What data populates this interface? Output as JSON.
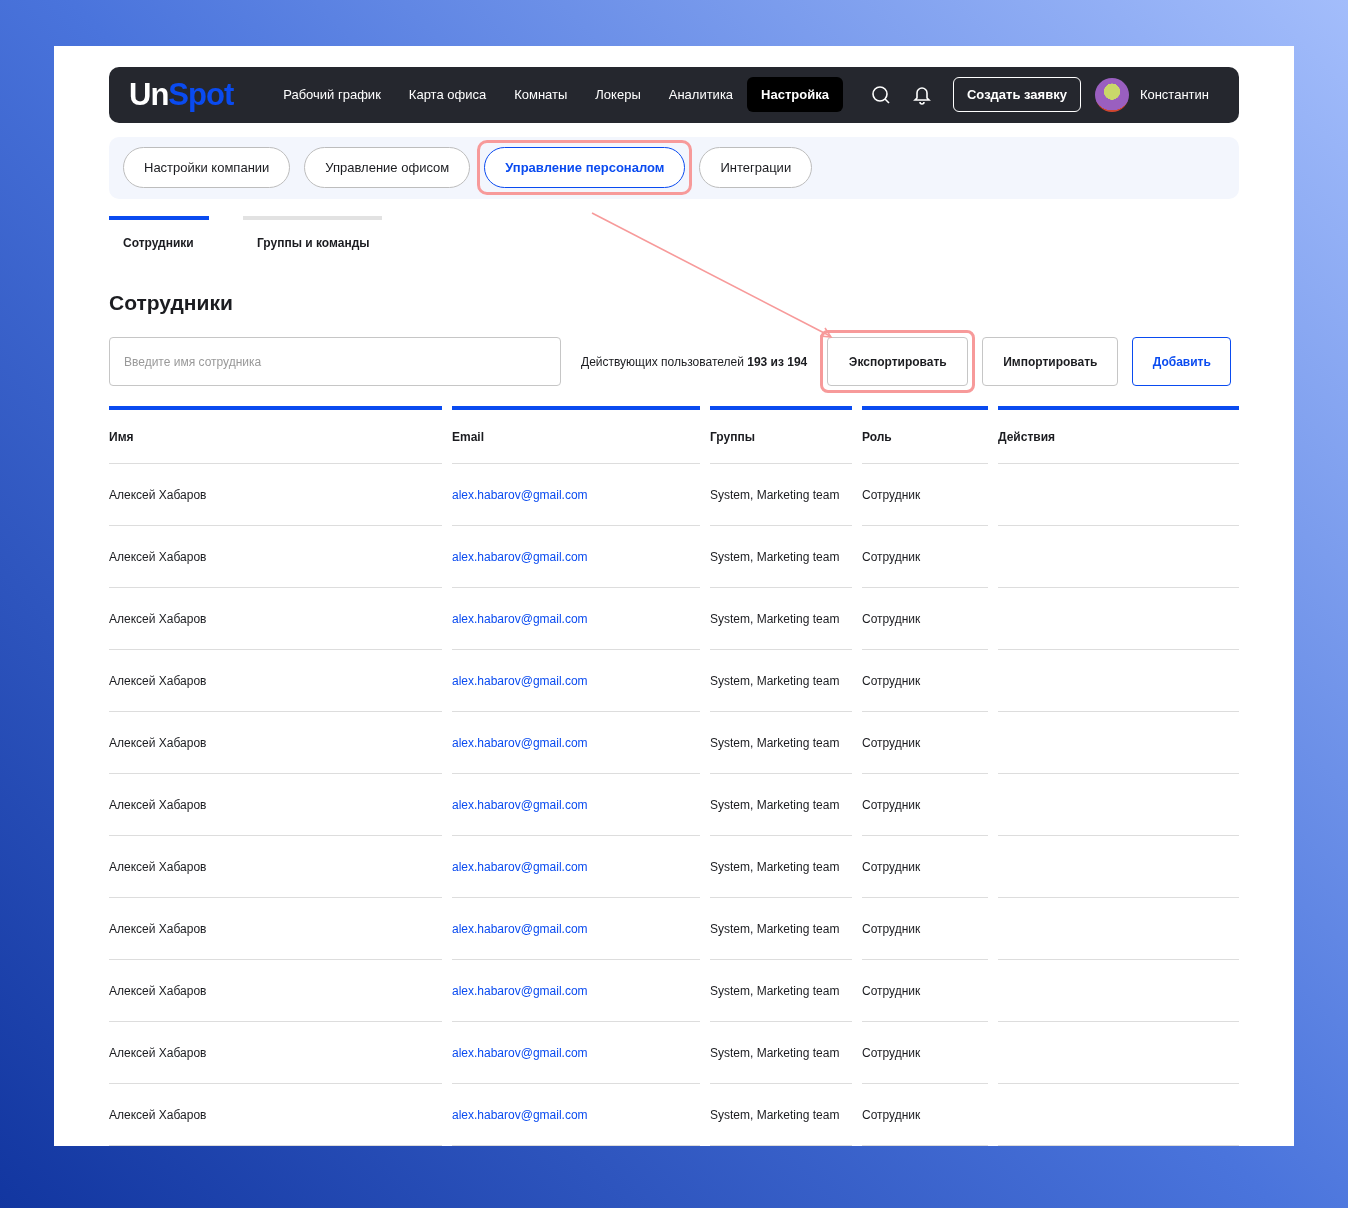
{
  "nav": {
    "logo_left": "Un",
    "logo_right": "Spot",
    "items": [
      {
        "label": "Рабочий график",
        "selected": false
      },
      {
        "label": "Карта офиса",
        "selected": false
      },
      {
        "label": "Комнаты",
        "selected": false
      },
      {
        "label": "Локеры",
        "selected": false
      },
      {
        "label": "Аналитика",
        "selected": false
      },
      {
        "label": "Настройка",
        "selected": true
      }
    ],
    "create_button": "Создать заявку",
    "user_name": "Константин"
  },
  "settings_tabs": [
    {
      "label": "Настройки компании",
      "selected": false,
      "highlighted": false
    },
    {
      "label": "Управление офисом",
      "selected": false,
      "highlighted": false
    },
    {
      "label": "Управление персоналом",
      "selected": true,
      "highlighted": true
    },
    {
      "label": "Интеграции",
      "selected": false,
      "highlighted": false
    }
  ],
  "tabs": [
    {
      "label": "Сотрудники",
      "selected": true
    },
    {
      "label": "Группы и команды",
      "selected": false
    }
  ],
  "heading": "Сотрудники",
  "search": {
    "placeholder": "Введите имя сотрудника"
  },
  "users_count": "Действующих пользователей **193 из 194**",
  "buttons": [
    {
      "label": "Экспортировать",
      "kind": "secondary",
      "highlighted": true
    },
    {
      "label": "Импортировать",
      "kind": "secondary",
      "highlighted": false
    },
    {
      "label": "Добавить",
      "kind": "primary",
      "highlighted": false
    }
  ],
  "table": {
    "columns": [
      "Имя",
      "Email",
      "Группы",
      "Роль",
      "Действия"
    ],
    "rows": [
      [
        "Алексей Хабаров",
        "alex.habarov@gmail.com",
        "System, Marketing team",
        "Сотрудник"
      ],
      [
        "Алексей Хабаров",
        "alex.habarov@gmail.com",
        "System, Marketing team",
        "Сотрудник"
      ],
      [
        "Алексей Хабаров",
        "alex.habarov@gmail.com",
        "System, Marketing team",
        "Сотрудник"
      ],
      [
        "Алексей Хабаров",
        "alex.habarov@gmail.com",
        "System, Marketing team",
        "Сотрудник"
      ],
      [
        "Алексей Хабаров",
        "alex.habarov@gmail.com",
        "System, Marketing team",
        "Сотрудник"
      ],
      [
        "Алексей Хабаров",
        "alex.habarov@gmail.com",
        "System, Marketing team",
        "Сотрудник"
      ],
      [
        "Алексей Хабаров",
        "alex.habarov@gmail.com",
        "System, Marketing team",
        "Сотрудник"
      ],
      [
        "Алексей Хабаров",
        "alex.habarov@gmail.com",
        "System, Marketing team",
        "Сотрудник"
      ],
      [
        "Алексей Хабаров",
        "alex.habarov@gmail.com",
        "System, Marketing team",
        "Сотрудник"
      ],
      [
        "Алексей Хабаров",
        "alex.habarov@gmail.com",
        "System, Marketing team",
        "Сотрудник"
      ],
      [
        "Алексей Хабаров",
        "alex.habarov@gmail.com",
        "System, Marketing team",
        "Сотрудник"
      ]
    ]
  }
}
